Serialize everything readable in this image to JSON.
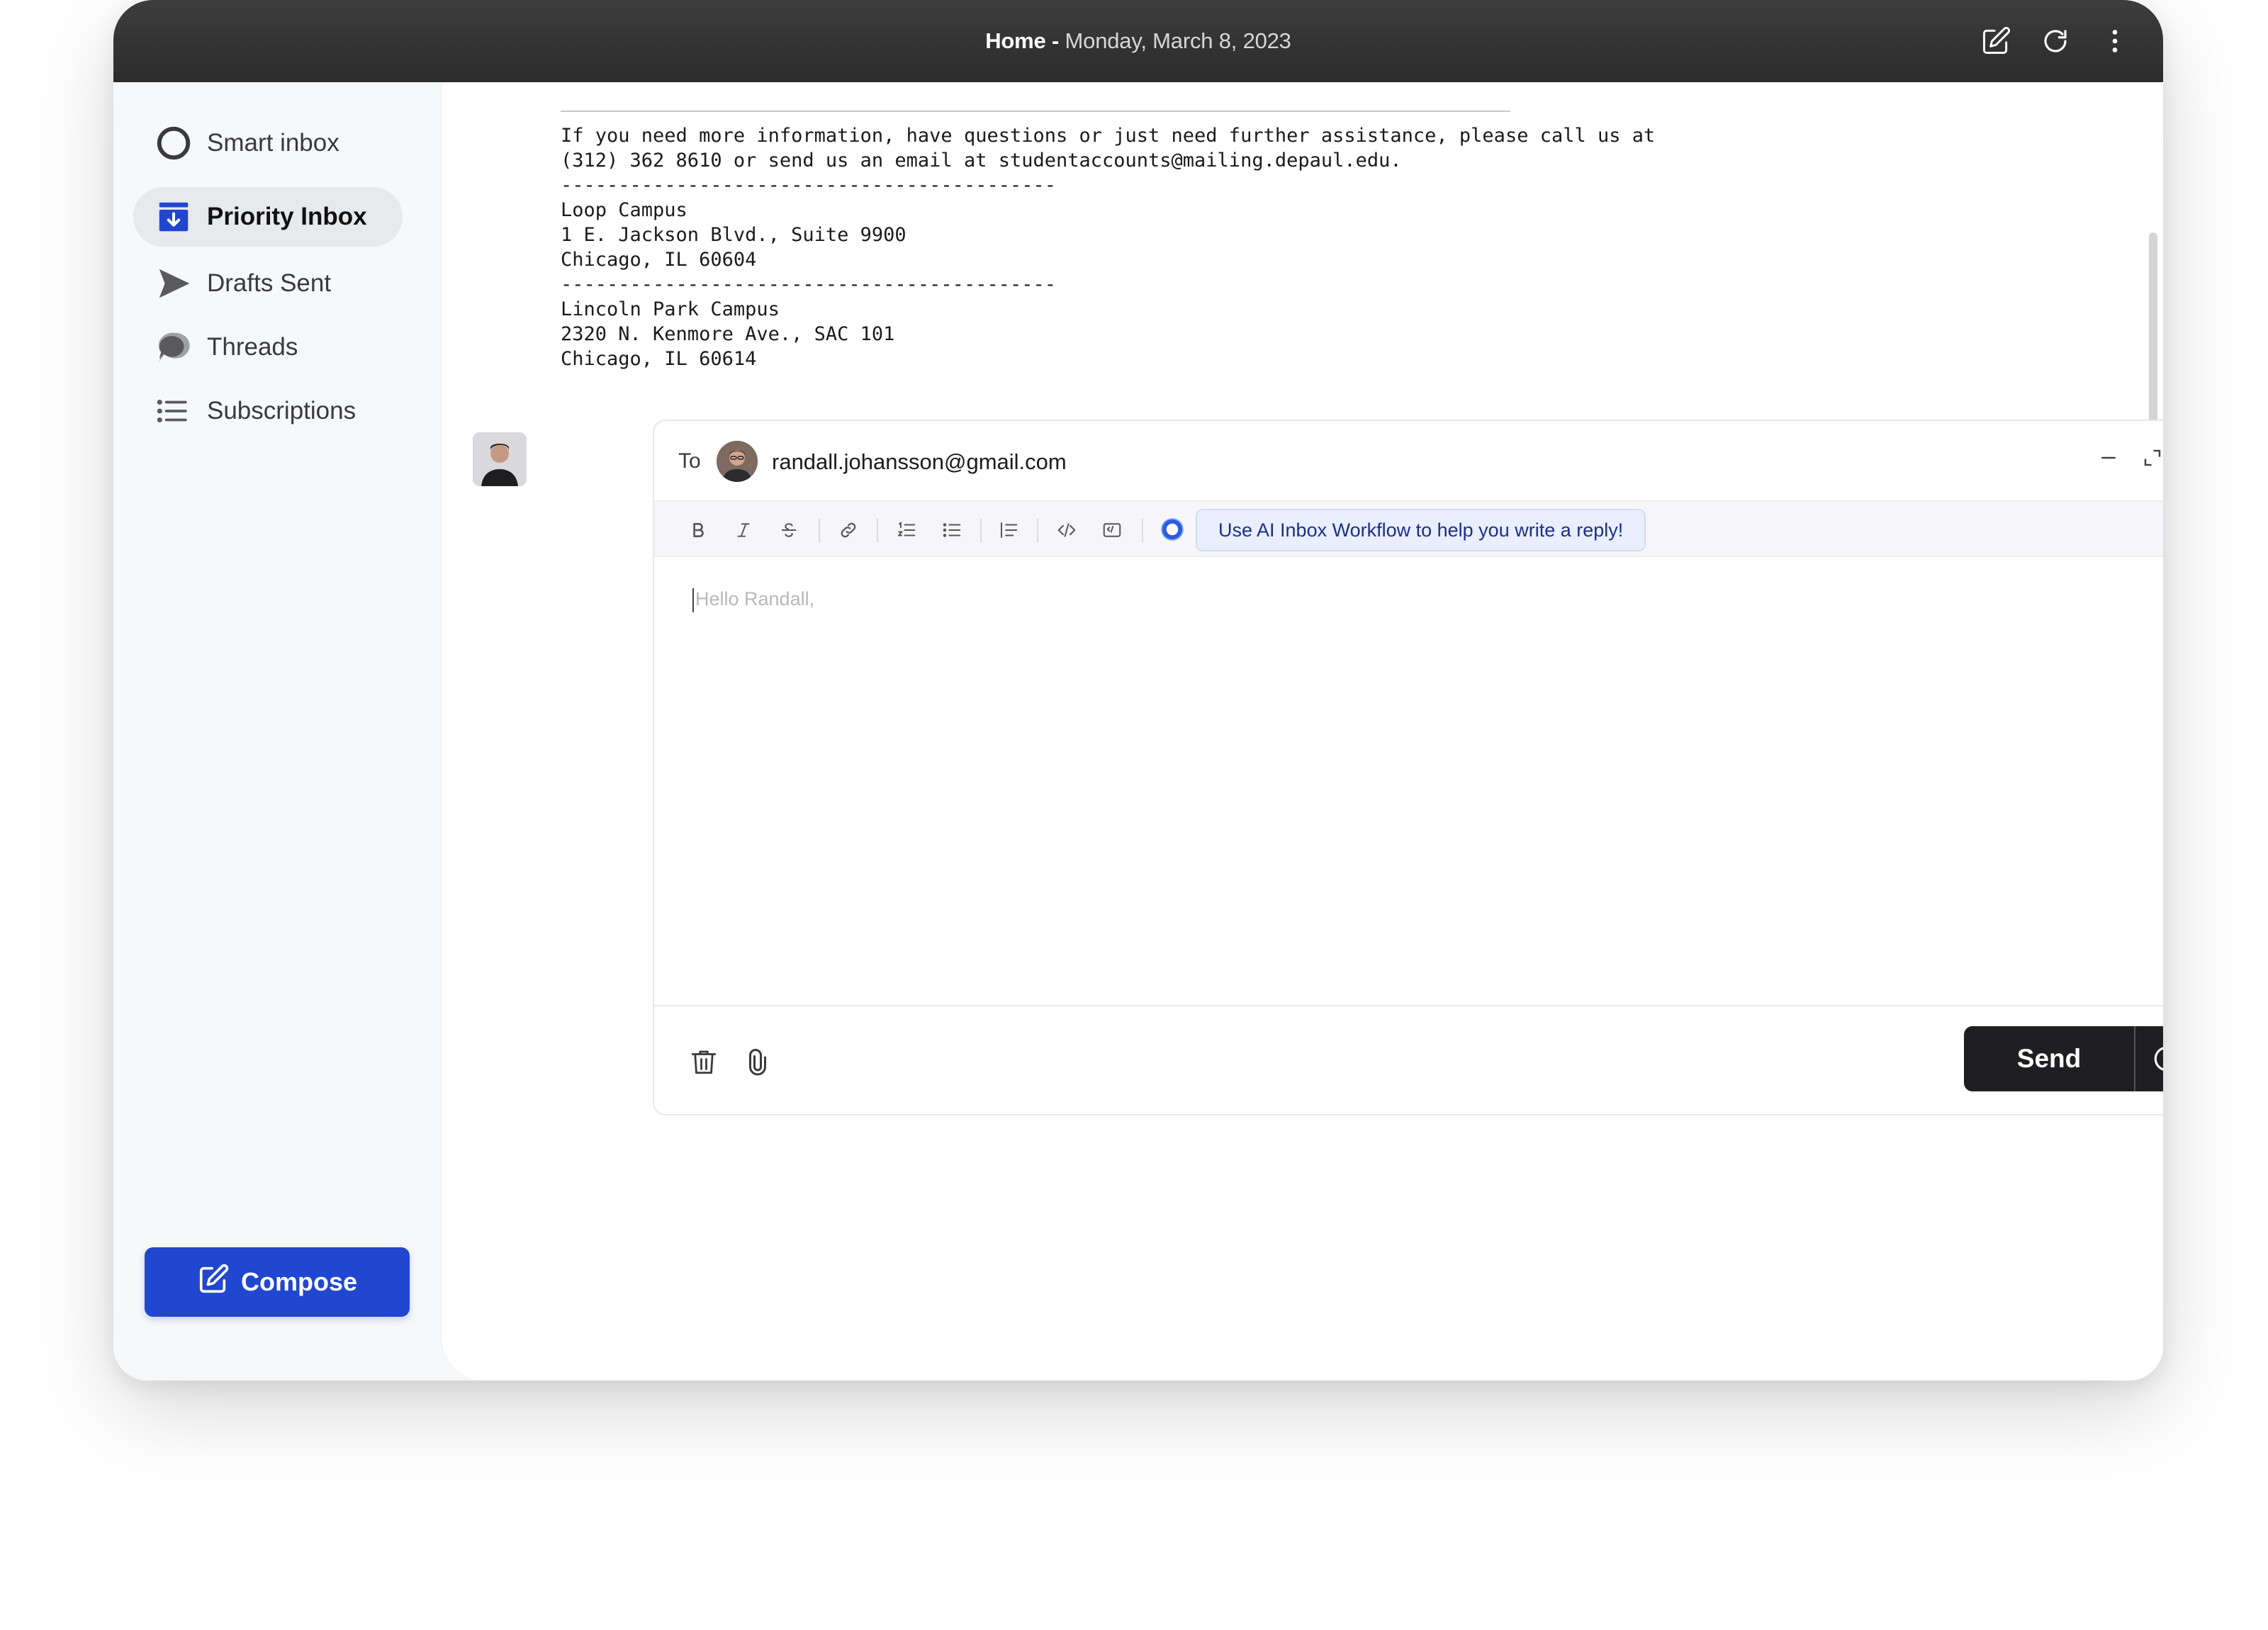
{
  "titlebar": {
    "home": "Home -",
    "date": "Monday, March 8, 2023",
    "icons": [
      "edit-icon",
      "refresh-icon",
      "more-vertical-icon"
    ]
  },
  "sidebar": {
    "items": [
      {
        "label": "Smart inbox",
        "icon": "ring-icon",
        "active": false
      },
      {
        "label": "Priority Inbox",
        "icon": "inbox-download-icon",
        "active": true
      },
      {
        "label": "Drafts Sent",
        "icon": "send-icon",
        "active": false
      },
      {
        "label": "Threads",
        "icon": "chat-bubbles-icon",
        "active": false
      },
      {
        "label": "Subscriptions",
        "icon": "list-icon",
        "active": false
      }
    ],
    "compose_label": "Compose"
  },
  "email": {
    "lines": [
      "If you need more information, have questions or just need further assistance, please call us at",
      "(312) 362 8610 or send us an email at studentaccounts@mailing.depaul.edu.",
      "-------------------------------------------",
      "Loop Campus",
      "1 E. Jackson Blvd., Suite 9900",
      "Chicago, IL 60604",
      "-------------------------------------------",
      "Lincoln Park Campus",
      "2320 N. Kenmore Ave., SAC 101",
      "Chicago, IL 60614"
    ]
  },
  "composer": {
    "to_label": "To",
    "recipient": "randall.johansson@gmail.com",
    "toolbar": [
      "bold-icon",
      "italic-icon",
      "strikethrough-icon",
      "link-icon",
      "ordered-list-icon",
      "bullet-list-icon",
      "blockquote-icon",
      "code-icon",
      "code-block-icon",
      "ai-icon"
    ],
    "ai_prompt": "Use AI Inbox Workflow to help you write a reply!",
    "placeholder": "Hello Randall,",
    "send_label": "Send"
  },
  "colors": {
    "accent": "#2146d0",
    "titlebar": "#333333",
    "send": "#1f1f21"
  }
}
